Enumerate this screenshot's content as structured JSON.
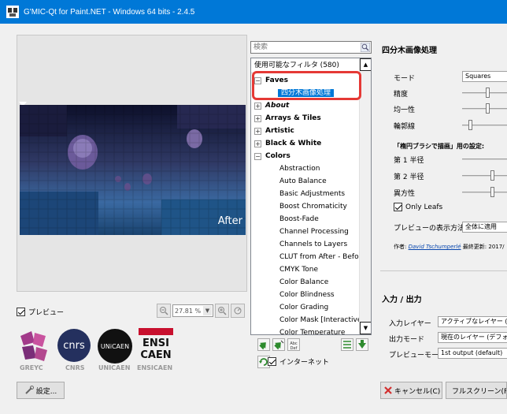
{
  "window": {
    "title": "G'MIC-Qt for Paint.NET - Windows 64 bits - 2.4.5"
  },
  "preview": {
    "after_label": "After",
    "checkbox_label": "プレビュー",
    "zoom_value": "27.81 %"
  },
  "logos": [
    "GREYC",
    "CNRS",
    "UNICAEN",
    "ENSICAEN"
  ],
  "logo_marks": {
    "cnrs": "cnrs",
    "unicaen": "UNiCAEN",
    "ensi_1": "ENSI",
    "ensi_2": "CAEN"
  },
  "settings_button": "設定...",
  "search": {
    "placeholder": "検索"
  },
  "filter_tree": {
    "header": "使用可能なフィルタ (580)",
    "faves": "Faves",
    "fave_item": "四分木画像処理",
    "groups": [
      "About",
      "Arrays & Tiles",
      "Artistic",
      "Black & White",
      "Colors"
    ],
    "colors_items": [
      "Abstraction",
      "Auto Balance",
      "Basic Adjustments",
      "Boost Chromaticity",
      "Boost-Fade",
      "Channel Processing",
      "Channels to Layers",
      "CLUT from After - Befor",
      "CMYK Tone",
      "Color Balance",
      "Color Blindness",
      "Color Grading",
      "Color Mask [Interactive]",
      "Color Temperature"
    ]
  },
  "internet_label": "インターネット",
  "tool_icons": {
    "random_label": "Abc\nDef"
  },
  "filter_panel": {
    "title": "四分木画像処理",
    "mode_label": "モード",
    "mode_value": "Squares",
    "precision_label": "精度",
    "homogeneity_label": "均一性",
    "outline_label": "輪郭線",
    "ellipse_section": "「楕円ブラシで描画」用の設定:",
    "radius1_label": "第 1 半径",
    "radius2_label": "第 2 半径",
    "anisotropy_label": "異方性",
    "only_leafs_label": "Only Leafs",
    "preview_method_label": "プレビューの表示方法",
    "preview_method_value": "全体に適用",
    "author_prefix": "作者:",
    "author_name": "David Tschumperlé",
    "updated_text": "最終更新: 2017/"
  },
  "io": {
    "title": "入力 / 出力",
    "input_label": "入力レイヤー",
    "input_value": "アクティブなレイヤー (デ",
    "output_label": "出力モード",
    "output_value": "現在のレイヤー (デフォ",
    "preview_mode_label": "プレビューモード",
    "preview_mode_value": "1st output (default)"
  },
  "buttons": {
    "cancel": "キャンセル(C)",
    "fullscreen": "フルスクリーン(F"
  },
  "colors": {
    "titlebar": "#0078d7",
    "selection": "#0078d7",
    "highlight": "#e53935"
  }
}
